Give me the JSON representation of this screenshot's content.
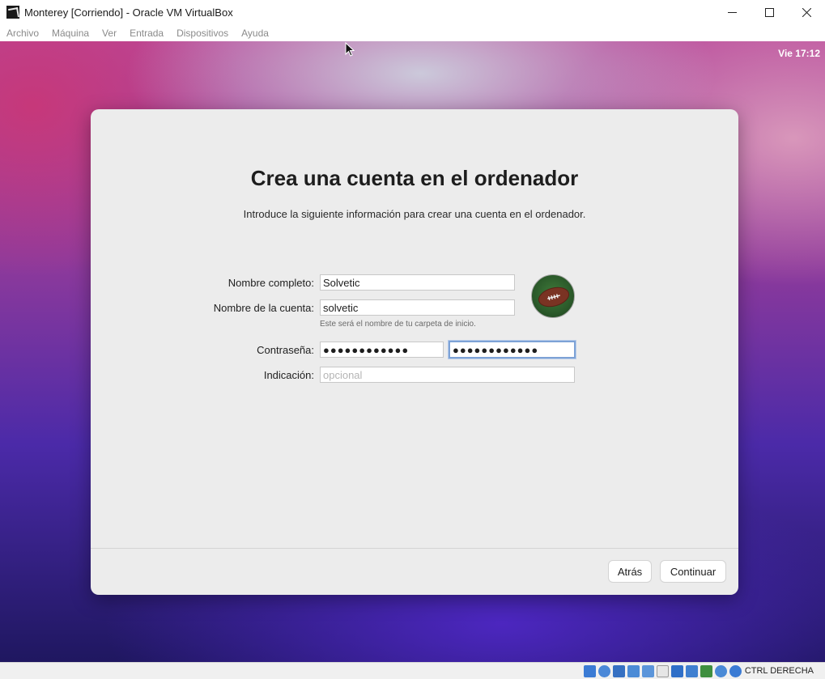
{
  "window": {
    "title": "Monterey [Corriendo] - Oracle VM VirtualBox",
    "icon": "virtualbox-icon",
    "controls": [
      "minimize-icon",
      "maximize-icon",
      "close-icon"
    ]
  },
  "menubar": {
    "items": [
      {
        "label": "Archivo"
      },
      {
        "label": "Máquina"
      },
      {
        "label": "Ver"
      },
      {
        "label": "Entrada"
      },
      {
        "label": "Dispositivos"
      },
      {
        "label": "Ayuda"
      }
    ]
  },
  "macos": {
    "clock": "Vie 17:12"
  },
  "dialog": {
    "title": "Crea una cuenta en el ordenador",
    "subtitle": "Introduce la siguiente información para crear una cuenta en el ordenador.",
    "full_name": {
      "label": "Nombre completo:",
      "value": "Solvetic"
    },
    "account_name": {
      "label": "Nombre de la cuenta:",
      "value": "solvetic",
      "hint": "Este será el nombre de tu carpeta de inicio."
    },
    "password": {
      "label": "Contraseña:",
      "value": "●●●●●●●●●●●●",
      "verify_value": "●●●●●●●●●●●●"
    },
    "hint": {
      "label": "Indicación:",
      "placeholder": "opcional",
      "value": ""
    },
    "avatar": "football-avatar-icon",
    "back_label": "Atrás",
    "continue_label": "Continuar"
  },
  "statusbar": {
    "host_key": "CTRL DERECHA",
    "icons": [
      "hard-disk-icon",
      "optical-drive-icon",
      "audio-icon",
      "network-icon",
      "usb-icon",
      "shared-folders-icon",
      "display-icon",
      "recording-icon",
      "cpu-icon",
      "mouse-integration-icon",
      "keyboard-icon"
    ]
  },
  "colors": {
    "focus_ring": "#7da2d6",
    "dialog_bg": "#ececec"
  }
}
